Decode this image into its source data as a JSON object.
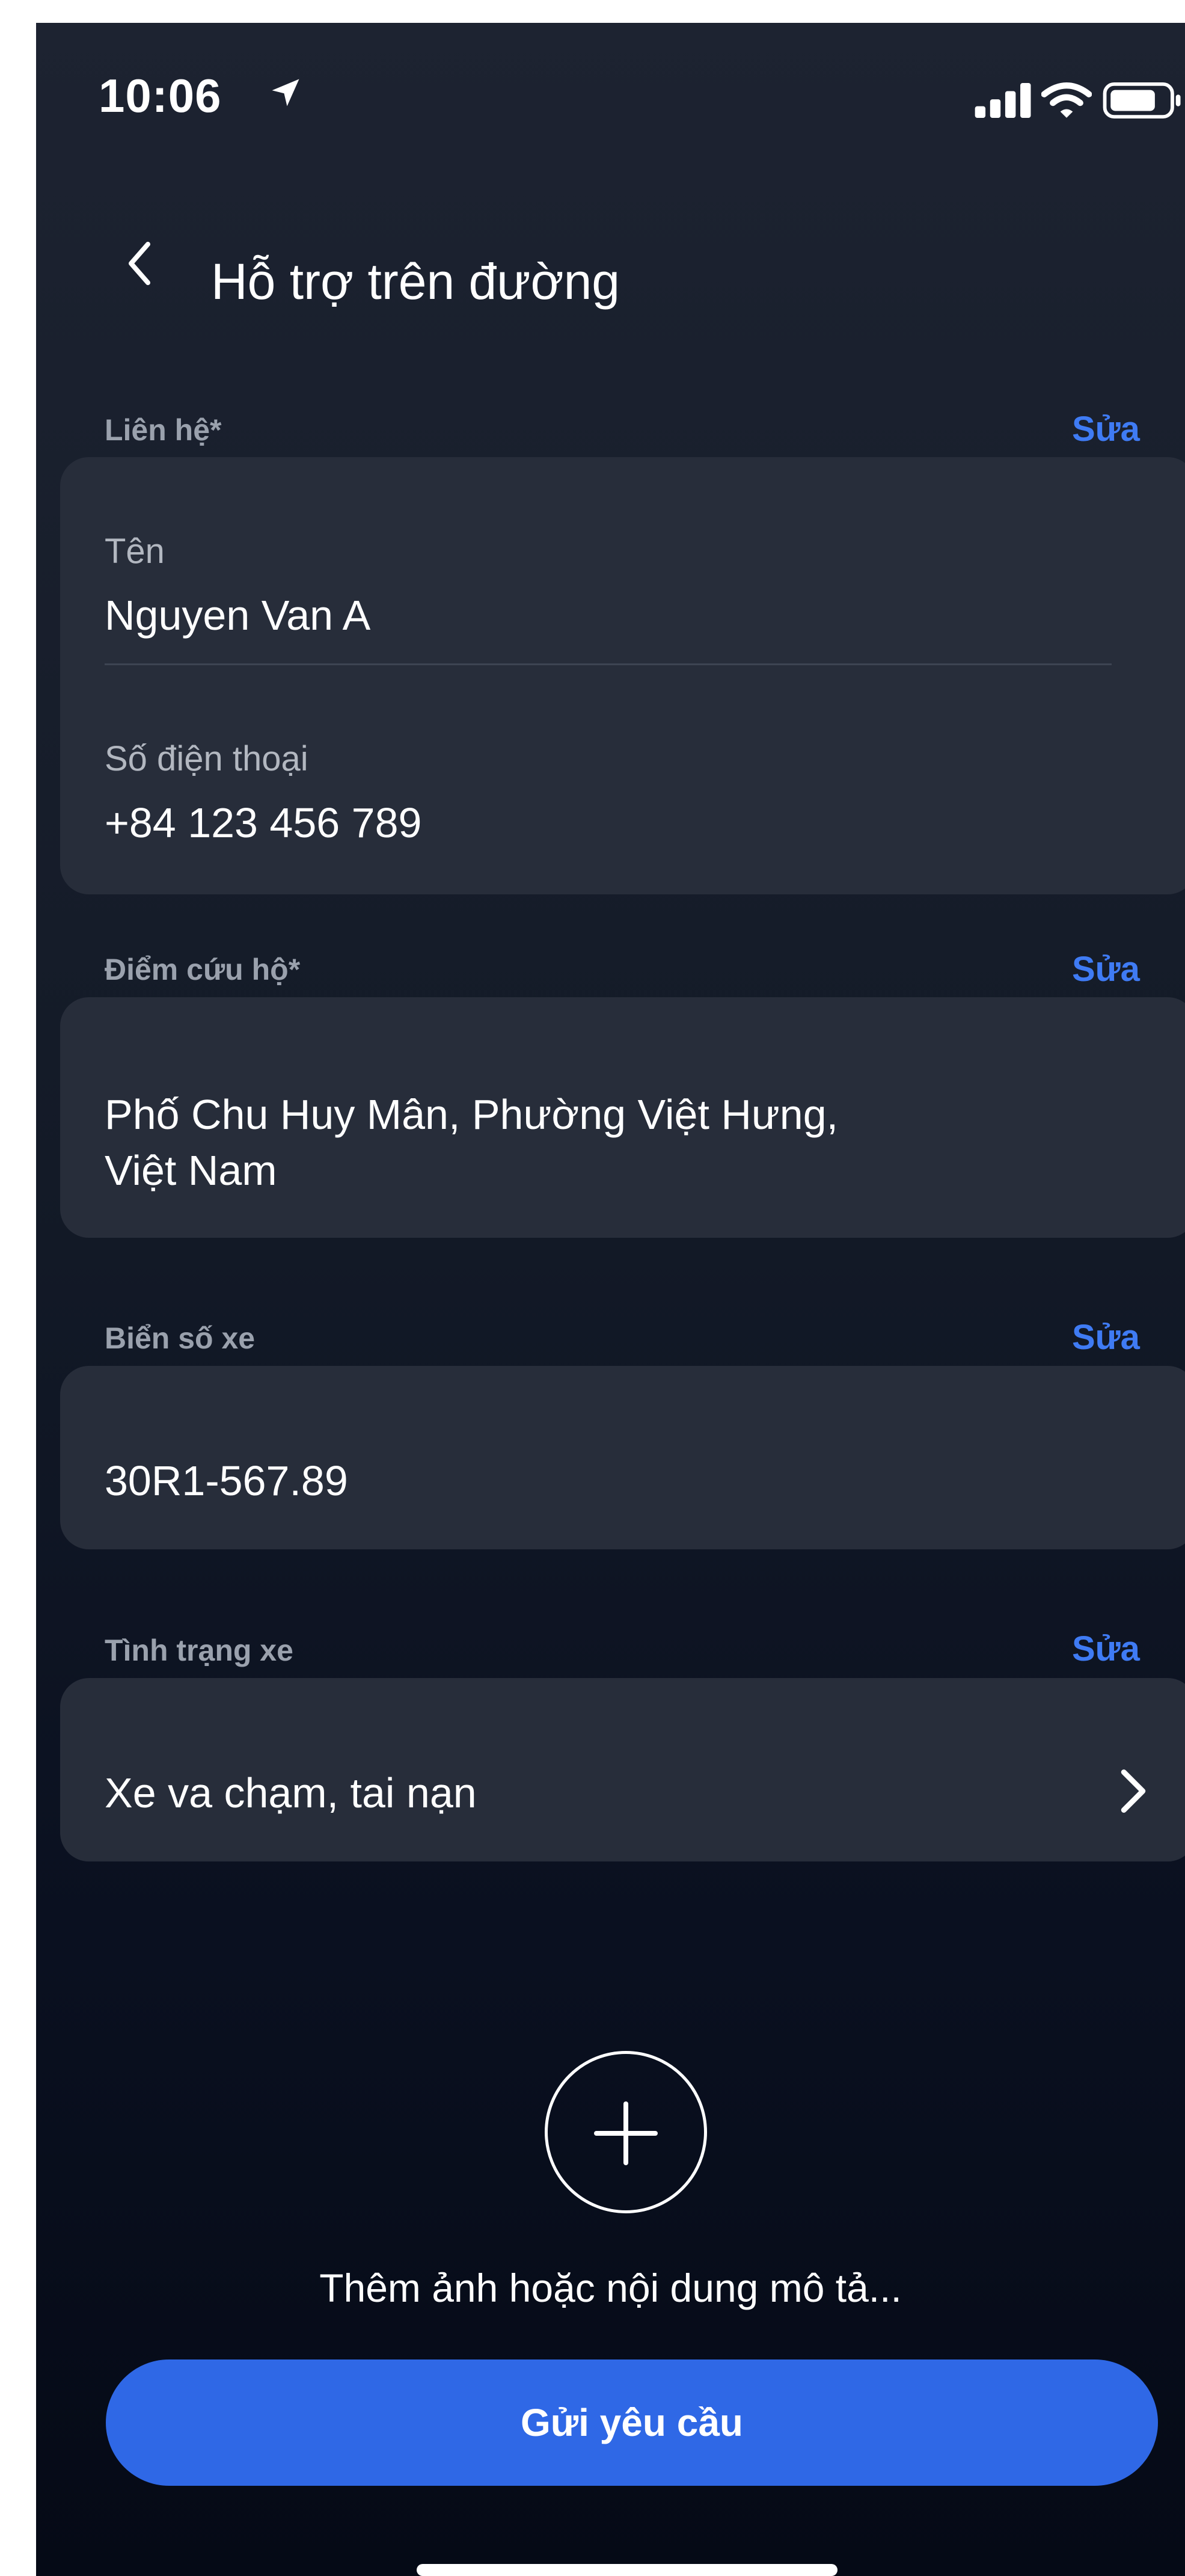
{
  "status_bar": {
    "time": "10:06"
  },
  "header": {
    "title": "Hỗ trợ trên đường"
  },
  "contact": {
    "label": "Liên hệ*",
    "edit": "Sửa",
    "name_label": "Tên",
    "name_value": "Nguyen Van A",
    "phone_label": "Số điện thoại",
    "phone_value": "+84 123 456 789"
  },
  "rescue_point": {
    "label": "Điểm cứu hộ*",
    "edit": "Sửa",
    "address_line1": "Phố Chu Huy Mân, Phường Việt Hưng,",
    "address_line2": "Việt Nam"
  },
  "plate": {
    "label": "Biển số xe",
    "edit": "Sửa",
    "value": "30R1-567.89"
  },
  "condition": {
    "label": "Tình trạng xe",
    "edit": "Sửa",
    "value": "Xe va chạm, tai nạn"
  },
  "attachment": {
    "hint": "Thêm ảnh hoặc nội dung mô tả..."
  },
  "submit": {
    "label": "Gửi yêu cầu"
  },
  "colors": {
    "accent": "#3f7bf4",
    "button": "#2f68e6",
    "card": "#272d3a",
    "background": "#131a27"
  },
  "icons": [
    "location-arrow-icon",
    "signal-icon",
    "wifi-icon",
    "battery-icon",
    "back-chevron-icon",
    "chevron-right-icon",
    "plus-icon"
  ]
}
